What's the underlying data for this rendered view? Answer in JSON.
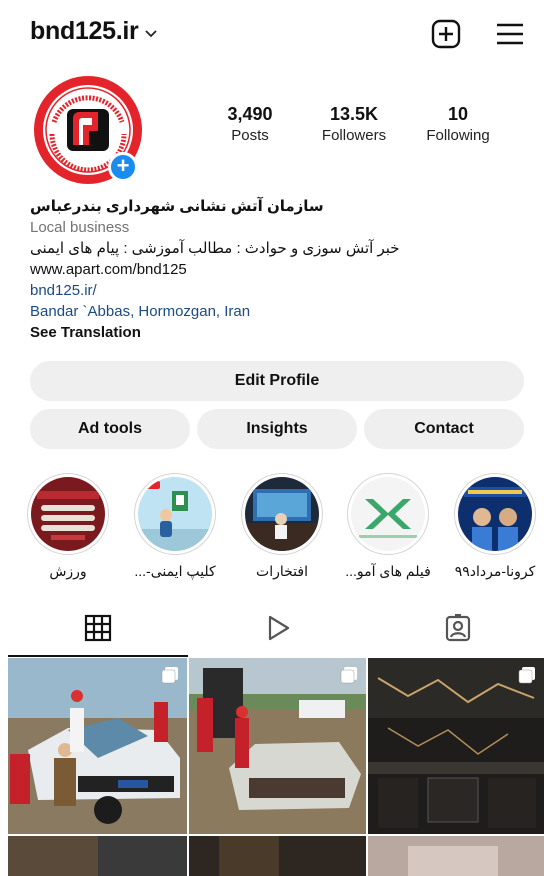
{
  "header": {
    "username": "bnd125.ir"
  },
  "stats": [
    {
      "value": "3,490",
      "label": "Posts"
    },
    {
      "value": "13.5K",
      "label": "Followers"
    },
    {
      "value": "10",
      "label": "Following"
    }
  ],
  "bio": {
    "name": "سازمان آتش نشانی شهرداری بندرعباس",
    "category": "Local business",
    "description": "خبر آتش سوزی و حوادث : مطالب آموزشی : پیام های ایمنی",
    "website_text": "www.apart.com/bnd125",
    "link": "bnd125.ir/",
    "location": "Bandar `Abbas, Hormozgan, Iran",
    "translate": "See Translation"
  },
  "logo_text": {
    "top_arc": "سازمان آتش نشانی و خدمات ایمنی شهرداری بندرعباس",
    "bottom_arc": "SAFETY SERVICES & FIREFIGHTING ORG."
  },
  "buttons": {
    "edit_profile": "Edit Profile",
    "ad_tools": "Ad tools",
    "insights": "Insights",
    "contact": "Contact"
  },
  "highlights": [
    {
      "caption": "ورزش"
    },
    {
      "caption": "کلیپ ایمنی-..."
    },
    {
      "caption": "افتخارات"
    },
    {
      "caption": "فیلم های آمو..."
    },
    {
      "caption": "کرونا-مرداد۹۹"
    }
  ],
  "tabs": {
    "active": "grid",
    "icons": [
      "grid-icon",
      "reels-icon",
      "tagged-icon"
    ]
  },
  "colors": {
    "brand_red": "#e3242b",
    "link_blue": "#1c4b82",
    "action_blue": "#1a8cf0",
    "button_bg": "#efefef"
  }
}
